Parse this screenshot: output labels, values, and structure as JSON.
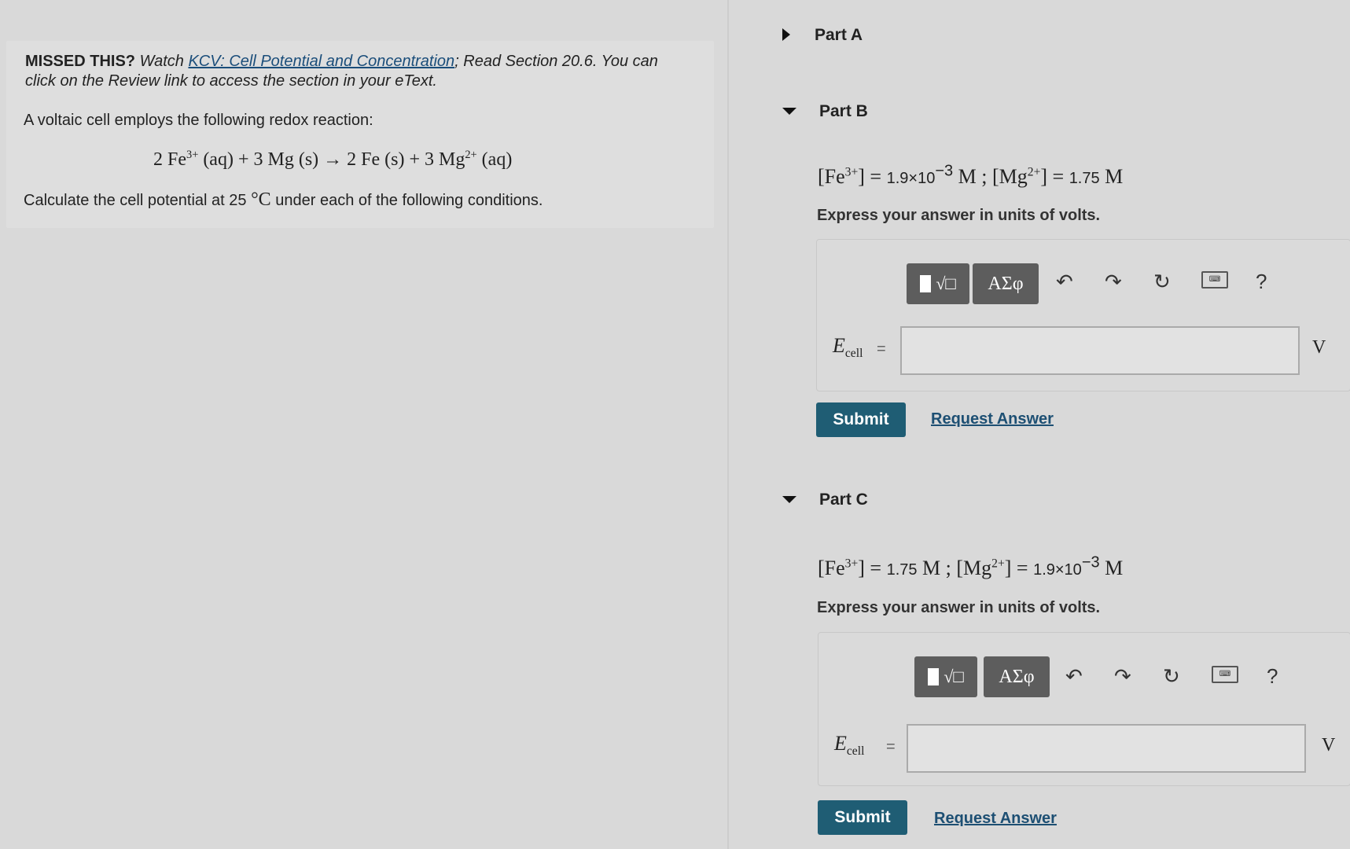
{
  "problem": {
    "missed_label": "MISSED THIS?",
    "missed_watch": " Watch ",
    "missed_link": "KCV: Cell Potential and Concentration",
    "missed_rest": "; Read Section 20.6. You can click on the Review link to access the section in your eText.",
    "intro": "A voltaic cell employs the following redox reaction:",
    "reaction": {
      "lhs": "2 Fe",
      "lhs_charge": "3+",
      "lhs_state": " (aq) + 3 Mg (s) → 2 Fe (s) + 3 Mg",
      "rhs_charge": "2+",
      "rhs_state": " (aq)"
    },
    "calc_prefix": "Calculate the cell potential at 25 ",
    "calc_unit": "°C",
    "calc_suffix": " under each of the following conditions."
  },
  "parts": {
    "a": {
      "title": "Part A"
    },
    "b": {
      "title": "Part B",
      "fe": "1.9×10",
      "fe_exp": "−3",
      "fe_unit": " M",
      "mg": "1.75",
      "mg_unit": " M",
      "express": "Express your answer in units of volts.",
      "input_value": "",
      "unit": "V",
      "submit": "Submit",
      "request": "Request Answer"
    },
    "c": {
      "title": "Part C",
      "fe": "1.75",
      "fe_unit": " M",
      "mg": "1.9×10",
      "mg_exp": "−3",
      "mg_unit": " M",
      "express": "Express your answer in units of volts.",
      "input_value": "",
      "unit": "V",
      "submit": "Submit",
      "request": "Request Answer"
    }
  },
  "toolbar": {
    "templates_label": "√□",
    "greek_label": "ΑΣφ",
    "undo_icon": "undo-icon",
    "redo_icon": "redo-icon",
    "reset_icon": "reset-icon",
    "keyboard_icon": "keyboard-icon",
    "help_label": "?"
  },
  "ecell": {
    "label": "E",
    "sub": "cell",
    "eq": "="
  }
}
